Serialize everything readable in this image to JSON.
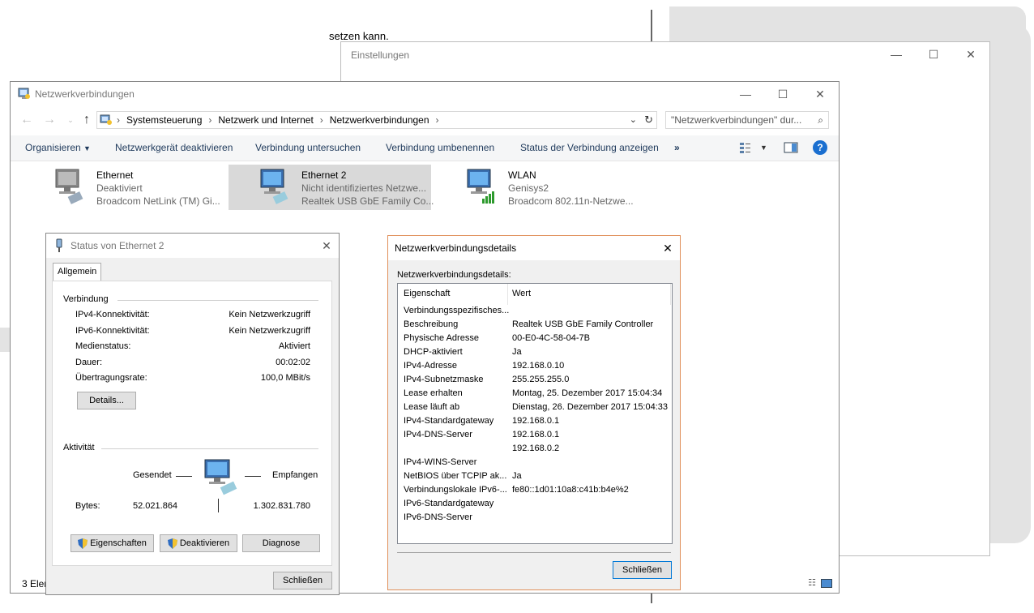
{
  "background": {
    "doc_text": "setzen kann."
  },
  "settings_window": {
    "title": "Einstellungen"
  },
  "netconn_window": {
    "title": "Netzwerkverbindungen",
    "breadcrumbs": [
      "Systemsteuerung",
      "Netzwerk und Internet",
      "Netzwerkverbindungen"
    ],
    "search_placeholder": "\"Netzwerkverbindungen\" dur...",
    "commands": [
      "Organisieren",
      "Netzwerkgerät deaktivieren",
      "Verbindung untersuchen",
      "Verbindung umbenennen",
      "Status der Verbindung anzeigen"
    ],
    "more_commands": "»",
    "adapters": [
      {
        "name": "Ethernet",
        "status": "Deaktiviert",
        "device": "Broadcom NetLink (TM) Gi..."
      },
      {
        "name": "Ethernet 2",
        "status": "Nicht identifiziertes Netzwe...",
        "device": "Realtek USB GbE Family Co..."
      },
      {
        "name": "WLAN",
        "status": "Genisys2",
        "device": "Broadcom 802.11n-Netzwe..."
      }
    ],
    "statusbar": "3 Elem"
  },
  "status_dialog": {
    "title": "Status von Ethernet 2",
    "tab": "Allgemein",
    "connection_group": "Verbindung",
    "connection": [
      {
        "label": "IPv4-Konnektivität:",
        "value": "Kein Netzwerkzugriff"
      },
      {
        "label": "IPv6-Konnektivität:",
        "value": "Kein Netzwerkzugriff"
      },
      {
        "label": "Medienstatus:",
        "value": "Aktiviert"
      },
      {
        "label": "Dauer:",
        "value": "00:02:02"
      },
      {
        "label": "Übertragungsrate:",
        "value": "100,0 MBit/s"
      }
    ],
    "details_button": "Details...",
    "activity_group": "Aktivität",
    "sent_label": "Gesendet",
    "received_label": "Empfangen",
    "bytes_label": "Bytes:",
    "bytes_sent": "52.021.864",
    "bytes_received": "1.302.831.780",
    "properties_button": "Eigenschaften",
    "disable_button": "Deaktivieren",
    "diagnose_button": "Diagnose",
    "close_button": "Schließen"
  },
  "details_dialog": {
    "title": "Netzwerkverbindungsdetails",
    "section_label": "Netzwerkverbindungsdetails:",
    "col_property": "Eigenschaft",
    "col_value": "Wert",
    "rows": [
      {
        "p": "Verbindungsspezifisches...",
        "v": ""
      },
      {
        "p": "Beschreibung",
        "v": "Realtek USB GbE Family Controller"
      },
      {
        "p": "Physische Adresse",
        "v": "00-E0-4C-58-04-7B"
      },
      {
        "p": "DHCP-aktiviert",
        "v": "Ja"
      },
      {
        "p": "IPv4-Adresse",
        "v": "192.168.0.10"
      },
      {
        "p": "IPv4-Subnetzmaske",
        "v": "255.255.255.0"
      },
      {
        "p": "Lease erhalten",
        "v": "Montag, 25. Dezember 2017 15:04:34"
      },
      {
        "p": "Lease läuft ab",
        "v": "Dienstag, 26. Dezember 2017 15:04:33"
      },
      {
        "p": "IPv4-Standardgateway",
        "v": "192.168.0.1"
      },
      {
        "p": "IPv4-DNS-Server",
        "v": "192.168.0.1"
      },
      {
        "p": "",
        "v": "192.168.0.2"
      },
      {
        "p": "IPv4-WINS-Server",
        "v": ""
      },
      {
        "p": "NetBIOS über TCPIP ak...",
        "v": "Ja"
      },
      {
        "p": "Verbindungslokale IPv6-...",
        "v": "fe80::1d01:10a8:c41b:b4e%2"
      },
      {
        "p": "IPv6-Standardgateway",
        "v": ""
      },
      {
        "p": "IPv6-DNS-Server",
        "v": ""
      }
    ],
    "close_button": "Schließen"
  }
}
